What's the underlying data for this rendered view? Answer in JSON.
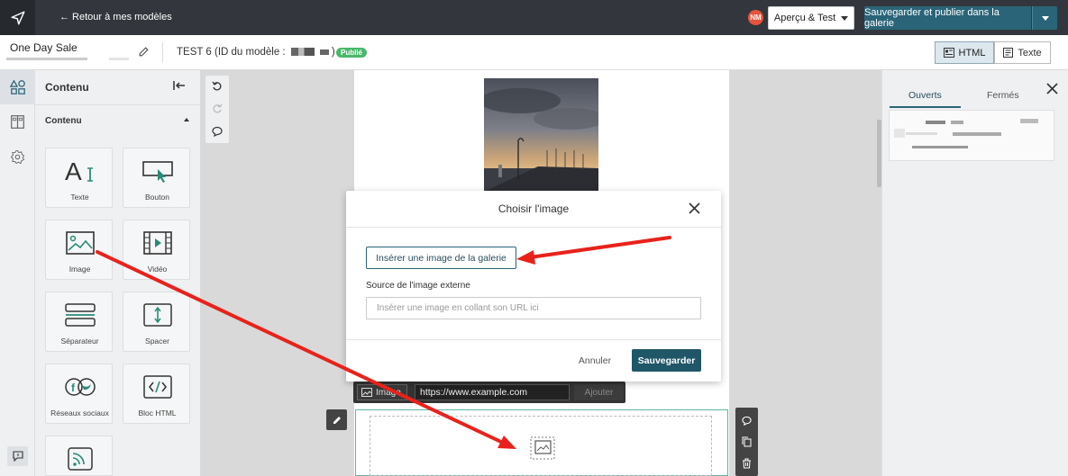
{
  "topbar": {
    "back_label": "← Retour à mes modèles",
    "avatar_initials": "NM",
    "preview_label": "Aperçu & Test",
    "publish_label": "Sauvegarder et publier dans la galerie"
  },
  "subbar": {
    "model_name": "One Day Sale",
    "template_name": "TEST 6",
    "template_id_label": "(ID du modèle :",
    "template_id_close": ")",
    "status_badge": "Publié",
    "html_label": "HTML",
    "text_label": "Texte"
  },
  "panel": {
    "title": "Contenu",
    "section": "Contenu",
    "tiles": [
      {
        "label": "Texte",
        "icon": "text-icon"
      },
      {
        "label": "Bouton",
        "icon": "button-icon"
      },
      {
        "label": "Image",
        "icon": "image-icon"
      },
      {
        "label": "Vidéo",
        "icon": "video-icon"
      },
      {
        "label": "Séparateur",
        "icon": "divider-icon"
      },
      {
        "label": "Spacer",
        "icon": "spacer-icon"
      },
      {
        "label": "Réseaux sociaux",
        "icon": "social-icon"
      },
      {
        "label": "Bloc HTML",
        "icon": "code-icon"
      },
      {
        "label": "",
        "icon": "rss-icon"
      }
    ]
  },
  "canvas": {
    "image_bar_label": "Image",
    "image_url_value": "https://www.example.com",
    "image_add_label": "Ajouter"
  },
  "right_panel": {
    "tab_open": "Ouverts",
    "tab_closed": "Fermés"
  },
  "modal": {
    "title": "Choisir l'image",
    "gallery_button": "Insérer une image de la galerie",
    "external_label": "Source de l'image externe",
    "external_placeholder": "Insérer une image en collant son URL ici",
    "cancel_label": "Annuler",
    "save_label": "Sauvegarder"
  },
  "colors": {
    "topbar": "#33373d",
    "primary": "#2a6478",
    "published": "#49b86a",
    "annotation": "#e8221b"
  }
}
